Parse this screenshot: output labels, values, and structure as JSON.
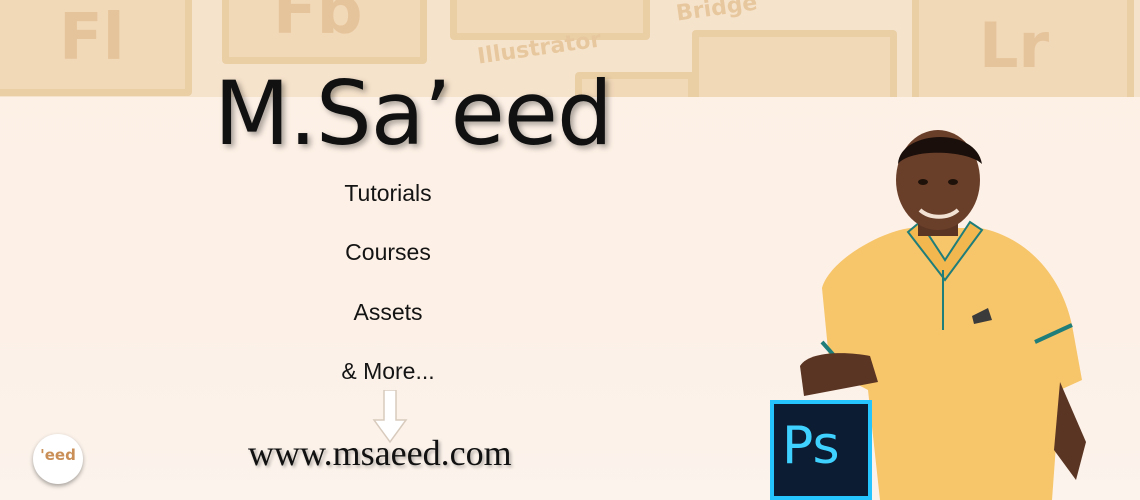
{
  "brand": {
    "name": "M.Sa’eed",
    "website": "www.msaeed.com",
    "logo_text": "'eed"
  },
  "menu": {
    "items": [
      {
        "label": "Tutorials"
      },
      {
        "label": "Courses"
      },
      {
        "label": "Assets"
      },
      {
        "label": "& More..."
      }
    ]
  },
  "background_tiles": {
    "labels": [
      "Fl",
      "Fb",
      "Illustrator",
      "Bridge",
      "Lr"
    ]
  },
  "badge": {
    "label": "Ps"
  },
  "colors": {
    "background": "#fdf1e6",
    "top_band": "#f6e3cc",
    "text": "#111111",
    "ps_bg": "#0c1c33",
    "ps_accent": "#26c4ff",
    "shirt": "#f7c56a"
  }
}
